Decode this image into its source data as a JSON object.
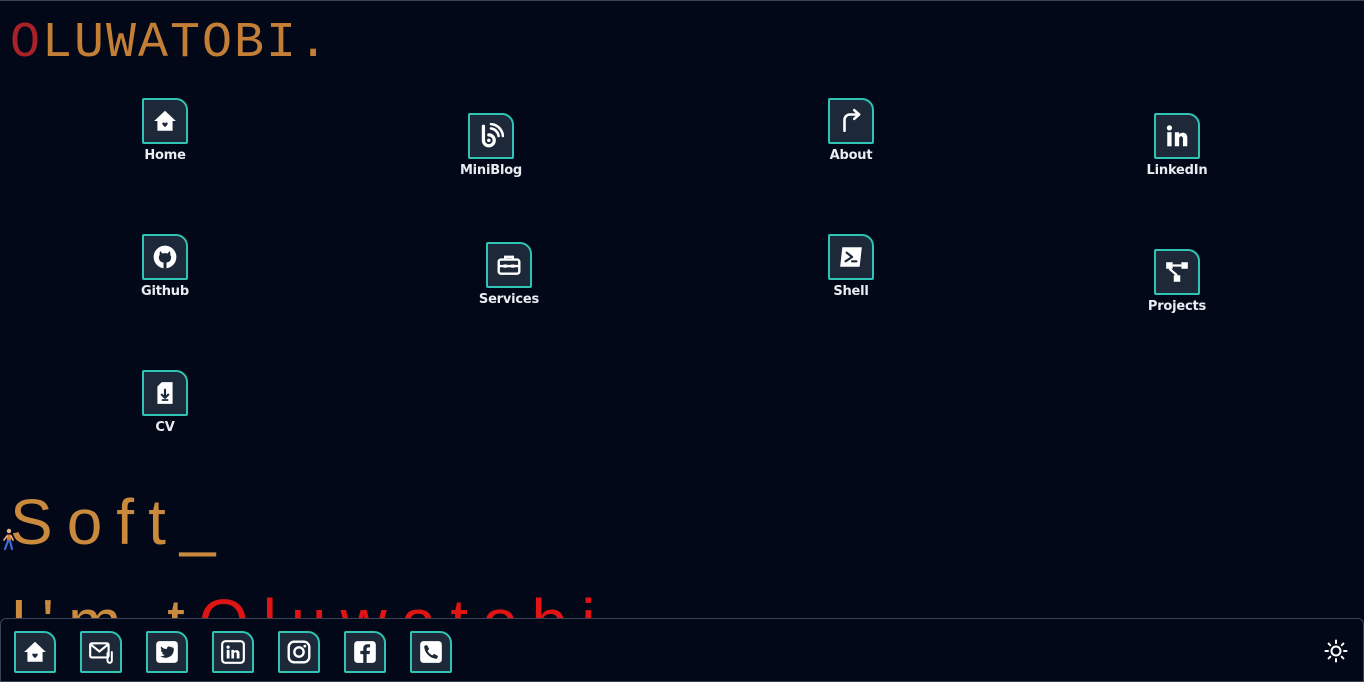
{
  "brand": {
    "first_letter": "O",
    "rest": "LUWATOBI",
    "dot": "."
  },
  "apps": [
    {
      "label": "Home",
      "icon": "home-icon"
    },
    {
      "label": "MiniBlog",
      "icon": "blog-icon"
    },
    {
      "label": "About",
      "icon": "share-icon"
    },
    {
      "label": "LinkedIn",
      "icon": "linkedin-icon"
    },
    {
      "label": "Github",
      "icon": "github-icon"
    },
    {
      "label": "Services",
      "icon": "toolbox-icon"
    },
    {
      "label": "Shell",
      "icon": "terminal-icon"
    },
    {
      "label": "Projects",
      "icon": "project-tree-icon"
    },
    {
      "label": "CV",
      "icon": "file-download-icon"
    }
  ],
  "hero": {
    "typed_text": "Soft",
    "cursor": "_",
    "second_line_part1": "I'm t",
    "second_line_part2": "Oluwatobi"
  },
  "dock": {
    "buttons": [
      "home-icon",
      "mail-attachment-icon",
      "twitter-icon",
      "linkedin-icon",
      "instagram-icon",
      "facebook-icon",
      "phone-icon"
    ],
    "theme_toggle_icon": "sun-icon"
  },
  "colors": {
    "background": "#030818",
    "accent_orange": "#c98a3e",
    "accent_red": "#a82228",
    "tile_border": "#2fc4b4",
    "tile_fill": "#1d2838"
  }
}
